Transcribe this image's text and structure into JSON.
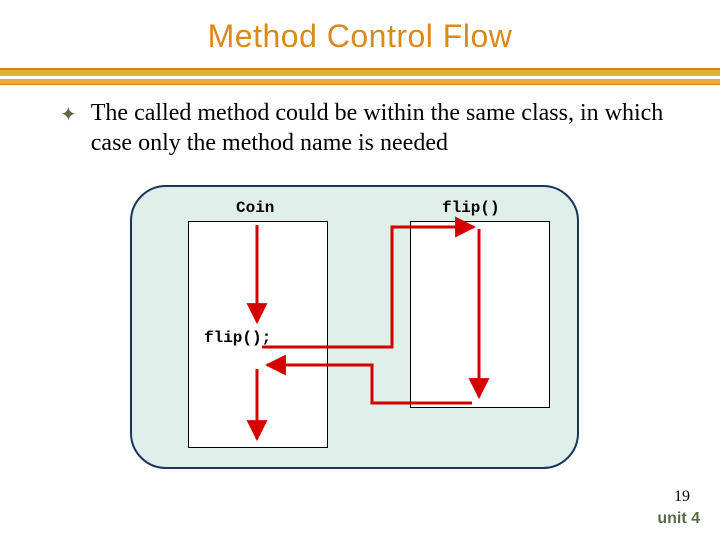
{
  "title": "Method Control Flow",
  "bullet": {
    "glyph": "✦",
    "text": "The called method could be within the same class, in which case only the method name is needed"
  },
  "diagram": {
    "left_box_label": "Coin",
    "right_box_label": "flip()",
    "call_stmt": "flip();"
  },
  "footer": {
    "page_number": "19",
    "unit": "unit 4"
  },
  "colors": {
    "accent_gold": "#e4ac39",
    "title_orange": "#d98a1a",
    "panel_teal": "#e1efeb",
    "arrow_red": "#d40000",
    "olive": "#5a6a48"
  }
}
